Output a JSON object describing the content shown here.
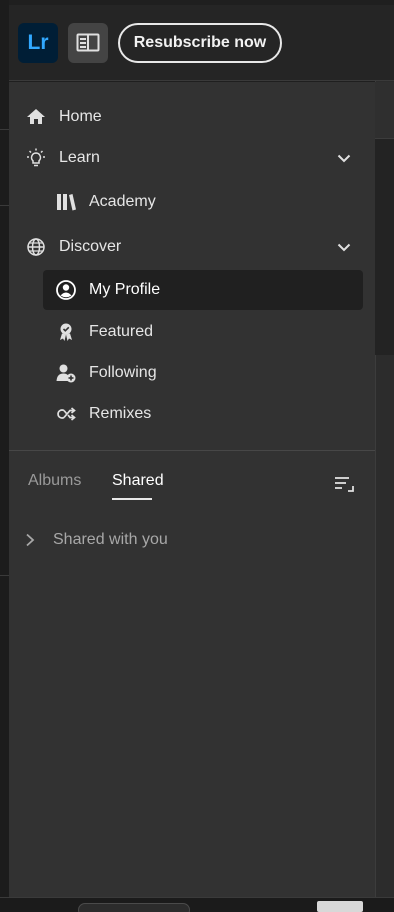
{
  "header": {
    "app_logo_text": "Lr",
    "resubscribe_label": "Resubscribe now"
  },
  "nav": {
    "home": "Home",
    "learn": "Learn",
    "academy": "Academy",
    "discover": "Discover",
    "my_profile": "My Profile",
    "featured": "Featured",
    "following": "Following",
    "remixes": "Remixes"
  },
  "tabs": {
    "albums": "Albums",
    "shared": "Shared"
  },
  "shared_with_you": "Shared with you",
  "icons": [
    "home-icon",
    "lightbulb-icon",
    "books-icon",
    "globe-icon",
    "profile-icon",
    "award-icon",
    "follow-user-icon",
    "remix-icon",
    "chevron-down-icon",
    "sort-icon",
    "chevron-right-icon",
    "panel-toggle-icon"
  ],
  "colors": {
    "accent_logo_bg": "#001e36",
    "accent_logo_text": "#31a8ff",
    "sidebar_bg": "#323232",
    "selected_bg": "#202020"
  }
}
